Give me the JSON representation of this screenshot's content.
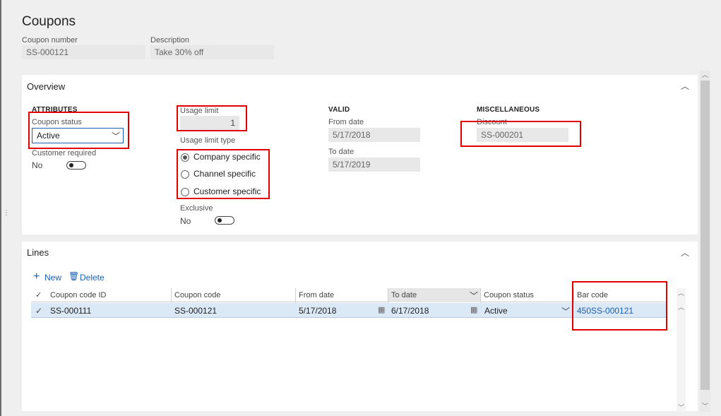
{
  "page": {
    "title": "Coupons"
  },
  "header": {
    "coupon_number_label": "Coupon number",
    "coupon_number_value": "SS-000121",
    "description_label": "Description",
    "description_value": "Take 30% off"
  },
  "overview": {
    "title": "Overview",
    "attributes": {
      "heading": "ATTRIBUTES",
      "coupon_status_label": "Coupon status",
      "coupon_status_value": "Active",
      "customer_required_label": "Customer required",
      "customer_required_value": "No"
    },
    "usage": {
      "usage_limit_label": "Usage limit",
      "usage_limit_value": "1",
      "usage_limit_type_label": "Usage limit type",
      "options": [
        "Company specific",
        "Channel specific",
        "Customer specific"
      ],
      "selected_option": "Company specific",
      "exclusive_label": "Exclusive",
      "exclusive_value": "No"
    },
    "valid": {
      "heading": "VALID",
      "from_date_label": "From date",
      "from_date_value": "5/17/2018",
      "to_date_label": "To date",
      "to_date_value": "5/17/2019"
    },
    "misc": {
      "heading": "MISCELLANEOUS",
      "discount_label": "Discount",
      "discount_value": "SS-000201"
    }
  },
  "lines": {
    "title": "Lines",
    "toolbar": {
      "new_label": "New",
      "delete_label": "Delete"
    },
    "columns": [
      "Coupon code ID",
      "Coupon code",
      "From date",
      "To date",
      "Coupon status",
      "Bar code"
    ],
    "rows": [
      {
        "coupon_code_id": "SS-000111",
        "coupon_code": "SS-000121",
        "from_date": "5/17/2018",
        "to_date": "6/17/2018",
        "coupon_status": "Active",
        "bar_code": "450SS-000121"
      }
    ]
  },
  "colors": {
    "accent": "#1a5fb4",
    "highlight": "#e00000",
    "selected_row": "#dbe8f6"
  }
}
